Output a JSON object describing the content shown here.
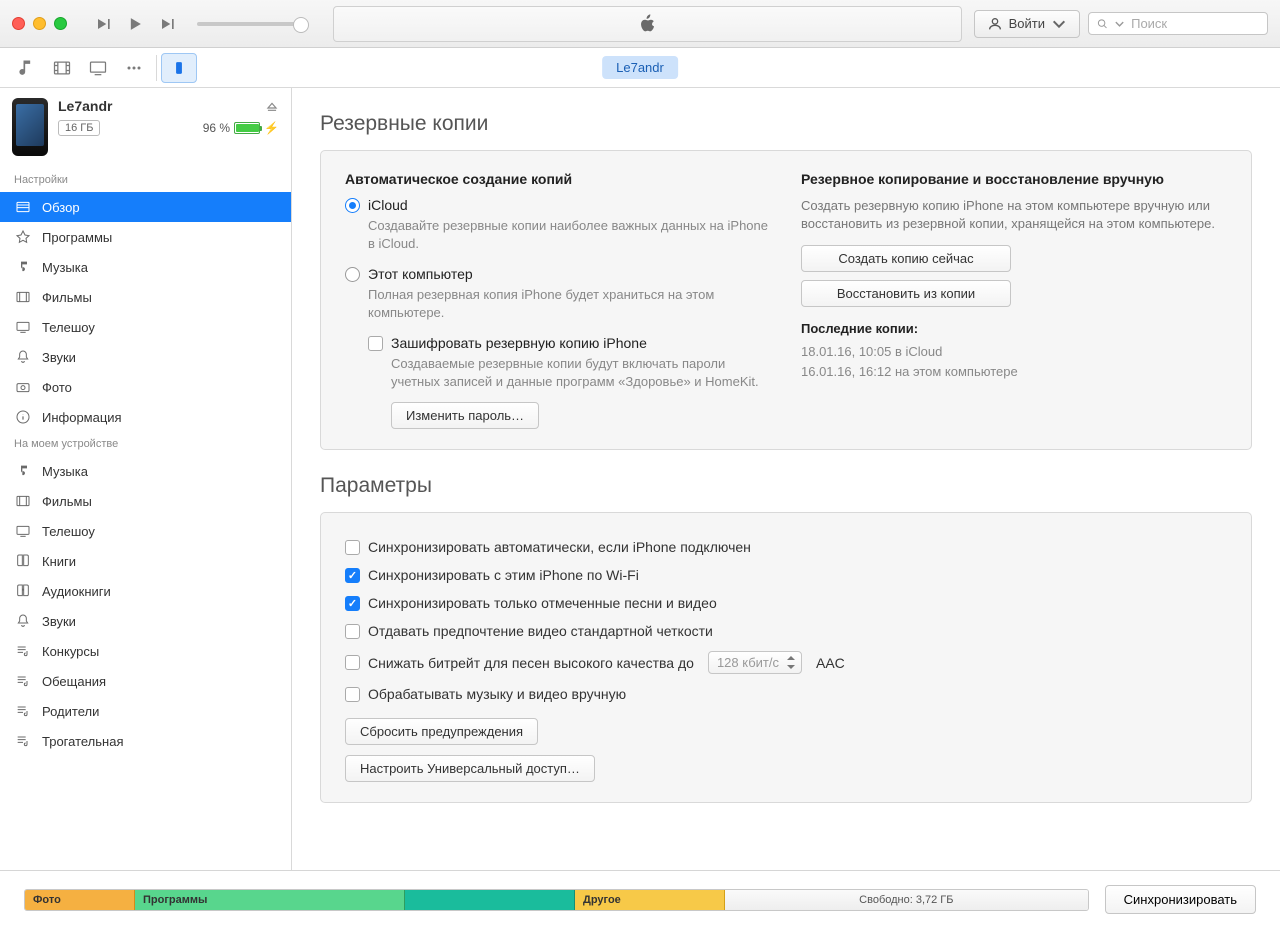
{
  "toolbar": {
    "account_label": "Войти",
    "search_placeholder": "Поиск",
    "device_chip": "Le7andr"
  },
  "device": {
    "name": "Le7andr",
    "capacity": "16 ГБ",
    "battery_pct": "96 %"
  },
  "sidebar": {
    "section_settings": "Настройки",
    "settings": [
      {
        "label": "Обзор"
      },
      {
        "label": "Программы"
      },
      {
        "label": "Музыка"
      },
      {
        "label": "Фильмы"
      },
      {
        "label": "Телешоу"
      },
      {
        "label": "Звуки"
      },
      {
        "label": "Фото"
      },
      {
        "label": "Информация"
      }
    ],
    "section_device": "На моем устройстве",
    "on_device": [
      {
        "label": "Музыка"
      },
      {
        "label": "Фильмы"
      },
      {
        "label": "Телешоу"
      },
      {
        "label": "Книги"
      },
      {
        "label": "Аудиокниги"
      },
      {
        "label": "Звуки"
      },
      {
        "label": "Конкурсы"
      },
      {
        "label": "Обещания"
      },
      {
        "label": "Родители"
      },
      {
        "label": "Трогательная"
      }
    ]
  },
  "backup": {
    "title": "Резервные копии",
    "auto_title": "Автоматическое создание копий",
    "icloud_label": "iCloud",
    "icloud_desc": "Создавайте резервные копии наиболее важных данных на iPhone в iCloud.",
    "computer_label": "Этот компьютер",
    "computer_desc": "Полная резервная копия iPhone будет храниться на этом компьютере.",
    "encrypt_label": "Зашифровать резервную копию iPhone",
    "encrypt_desc": "Создаваемые резервные копии будут включать пароли учетных записей и данные программ «Здоровье» и HomeKit.",
    "change_pw": "Изменить пароль…",
    "manual_title": "Резервное копирование и восстановление вручную",
    "manual_desc": "Создать резервную копию iPhone на этом компьютере вручную или восстановить из резервной копии, хранящейся на этом компьютере.",
    "backup_now": "Создать копию сейчас",
    "restore": "Восстановить из копии",
    "last_title": "Последние копии:",
    "last_icloud": "18.01.16, 10:05 в iCloud",
    "last_computer": "16.01.16, 16:12 на этом компьютере"
  },
  "options": {
    "title": "Параметры",
    "items": [
      {
        "label": "Синхронизировать автоматически, если iPhone подключен",
        "checked": false
      },
      {
        "label": "Синхронизировать с этим iPhone по Wi-Fi",
        "checked": true
      },
      {
        "label": "Синхронизировать только отмеченные песни и видео",
        "checked": true
      },
      {
        "label": "Отдавать предпочтение видео стандартной четкости",
        "checked": false
      },
      {
        "label": "Снижать битрейт для песен высокого качества до",
        "checked": false
      },
      {
        "label": "Обрабатывать музыку и видео вручную",
        "checked": false
      }
    ],
    "bitrate_value": "128 кбит/с",
    "bitrate_suffix": "AAC",
    "reset_warnings": "Сбросить предупреждения",
    "configure_access": "Настроить Универсальный доступ…"
  },
  "storage": {
    "photo": "Фото",
    "apps": "Программы",
    "other": "Другое",
    "free": "Свободно: 3,72 ГБ",
    "sync": "Синхронизировать"
  }
}
